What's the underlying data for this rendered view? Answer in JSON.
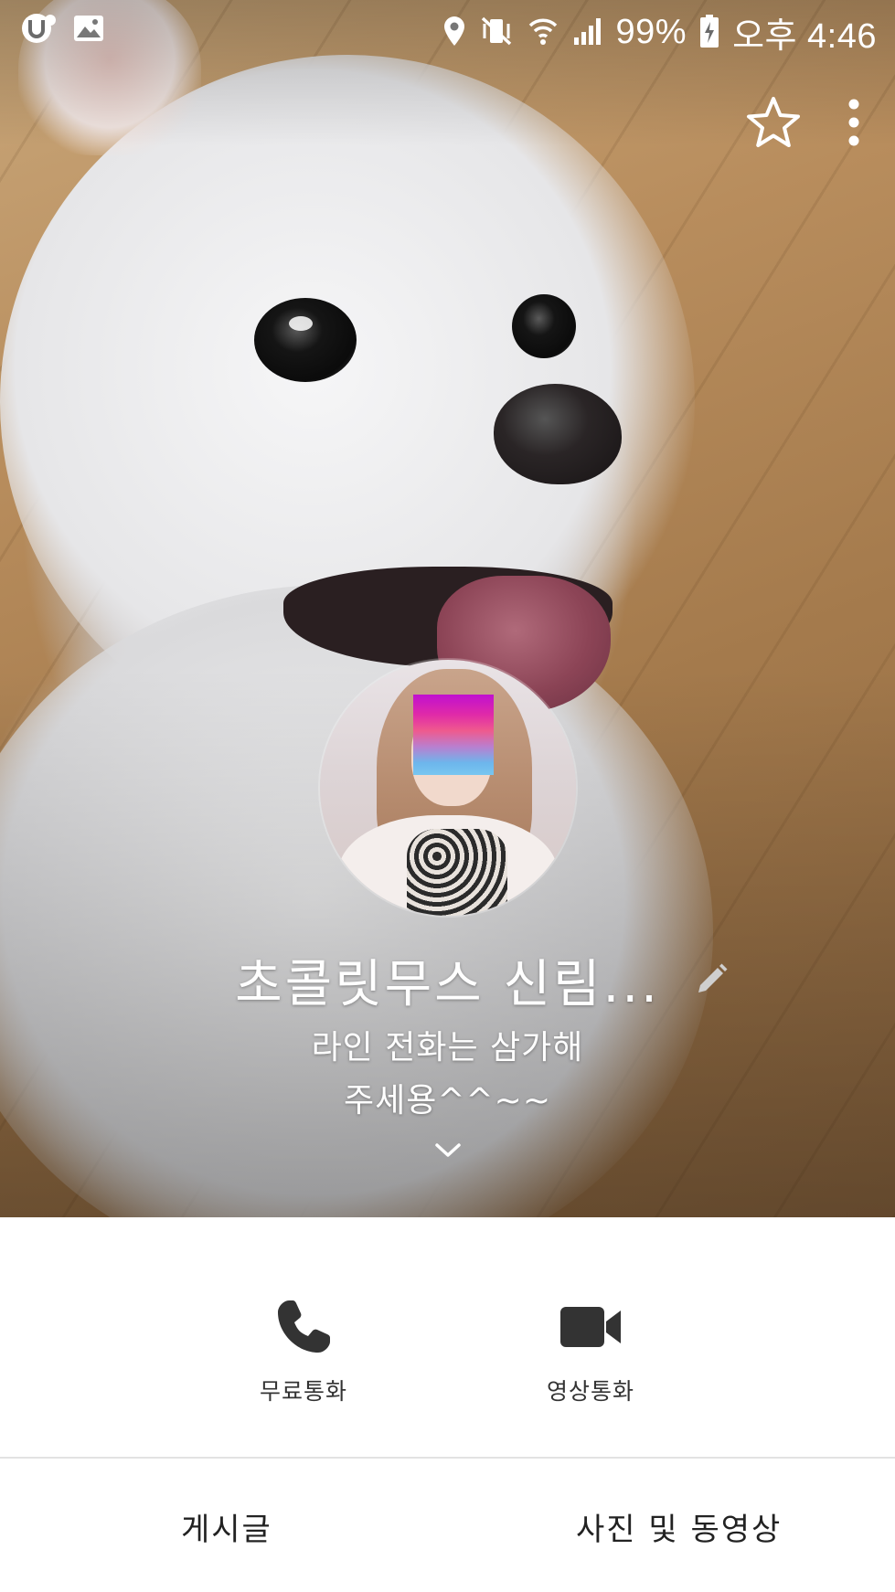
{
  "status_bar": {
    "left_icons": [
      "u-plus-icon",
      "gallery-icon"
    ],
    "right_icons": [
      "location-icon",
      "vibrate-mute-icon",
      "wifi-icon",
      "signal-icon",
      "battery-charging-icon"
    ],
    "battery": "99%",
    "time": "오후 4:46"
  },
  "header": {
    "favorite_icon": "star-outline-icon",
    "more_icon": "more-vertical-icon"
  },
  "profile": {
    "name": "초콜릿무스 신림...",
    "status_lines": [
      "라인 전화는 삼가해",
      "주세용^^~~"
    ],
    "edit_icon": "pencil-icon",
    "expand_icon": "chevron-down-icon"
  },
  "actions": {
    "free_call": {
      "label": "무료통화",
      "icon": "phone-icon"
    },
    "video_call": {
      "label": "영상통화",
      "icon": "video-camera-icon"
    }
  },
  "tabs": [
    {
      "label": "게시글"
    },
    {
      "label": "사진 및 동영상"
    }
  ],
  "colors": {
    "icon_dark": "#333333",
    "text_dark": "#222222",
    "divider": "#e2e2e2",
    "overlay_text": "#ffffff"
  }
}
